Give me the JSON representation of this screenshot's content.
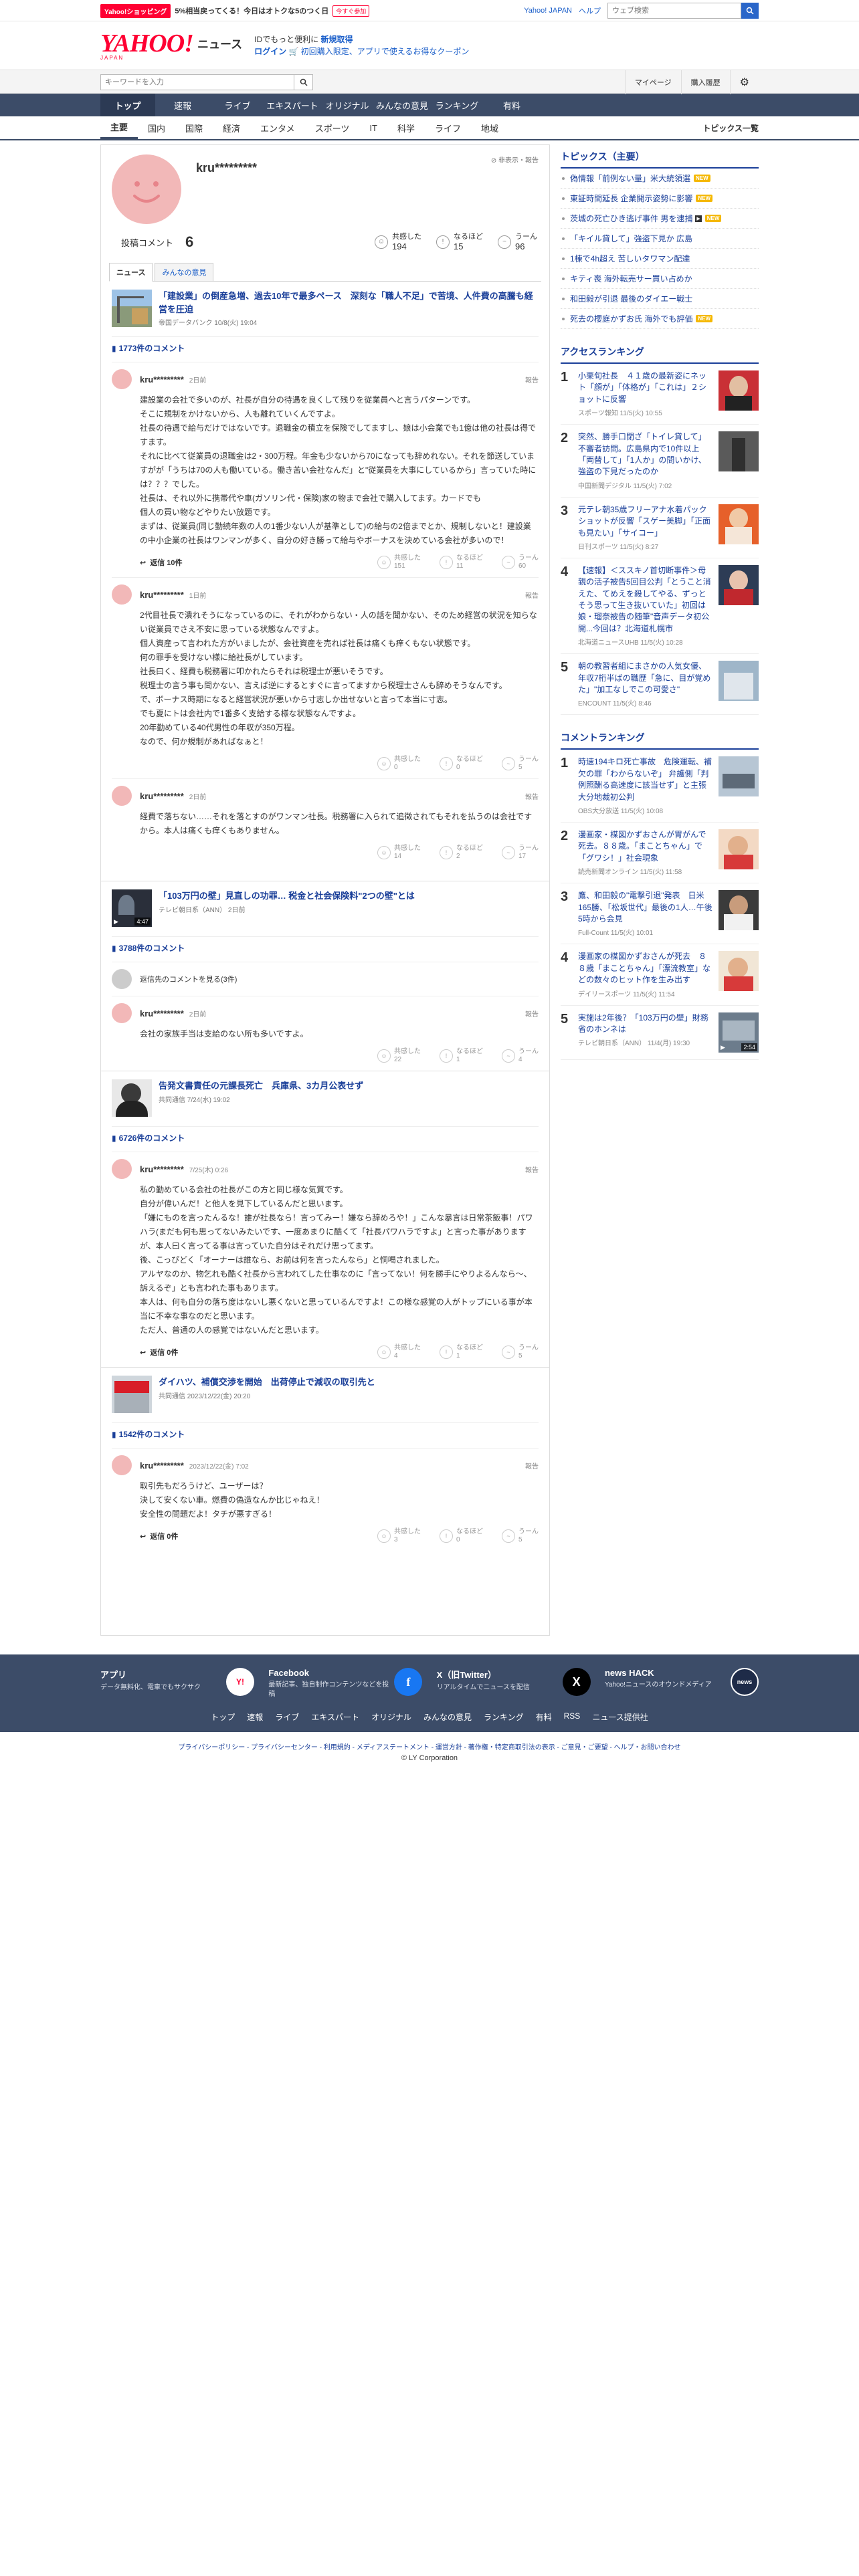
{
  "topbar": {
    "shop_badge": "Yahoo!ショッピング",
    "promo": "5%相当戻ってくる！今日はオトクな5のつく日",
    "promo_btn": "今すぐ参加",
    "links": [
      "Yahoo! JAPAN",
      "ヘルプ"
    ],
    "search_placeholder": "ウェブ検索"
  },
  "logo": {
    "main": "YAHOO!",
    "sub": "JAPAN",
    "section": "ニュース",
    "promo_line1_prefix": "IDでもっと便利に",
    "promo_line1_link": "新規取得",
    "promo_line2_login": "ログイン",
    "promo_line2_text": "初回購入限定、アプリで使えるお得なクーポン"
  },
  "subbar": {
    "keyword_placeholder": "キーワードを入力",
    "links": [
      "マイページ",
      "購入履歴"
    ]
  },
  "mainnav": [
    "トップ",
    "速報",
    "ライブ",
    "エキスパート",
    "オリジナル",
    "みんなの意見",
    "ランキング",
    "有料"
  ],
  "catnav": {
    "items": [
      "主要",
      "国内",
      "国際",
      "経済",
      "エンタメ",
      "スポーツ",
      "IT",
      "科学",
      "ライフ",
      "地域"
    ],
    "list_link": "トピックス一覧"
  },
  "profile": {
    "name": "kru*********",
    "report": "非表示・報告",
    "comments_label": "投稿コメント",
    "comments_count": "6",
    "reactions": [
      {
        "label": "共感した",
        "value": "194"
      },
      {
        "label": "なるほど",
        "value": "15"
      },
      {
        "label": "うーん",
        "value": "96"
      }
    ]
  },
  "tabs": [
    "ニュース",
    "みんなの意見"
  ],
  "threads": [
    {
      "title": "「建設業」の倒産急増、過去10年で最多ペース　深刻な「職人不足」で苦境、人件費の高騰も経営を圧迫",
      "meta": "帝国データバンク 10/8(火) 19:04",
      "comment_count": "1773件のコメント",
      "comments": [
        {
          "user": "kru*********",
          "time": "2日前",
          "report": "報告",
          "body": "建設業の会社で多いのが、社長が自分の待遇を良くして残りを従業員へと言うパターンです。\nそこに規制をかけないから、人も離れていくんですよ。\n社長の待遇で給与だけではないです。退職金の積立を保険でしてますし、娘は小会業でも1億は他の社長は得ですます。\nそれに比べて従業員の退職金は2・300万程。年金も少ないから70になっても辞めれない。それを節送していますがが「うちは70の人も働いている。働き苦い会社なんだ」と\"従業員を大事にしているから」言っていた時には？？？でした。\n社長は、それ以外に携帯代や車(ガソリン代・保険)家の物まで会社で購入してます。カードでも\n個人の買い物などやりたい放題です。\nまずは、従業員(同じ勤続年数の人の1番少ない人が基準として)の給与の2倍までとか、規制しないと！建設業の中小企業の社長はワンマンが多く、自分の好き勝って給与やボーナスを決めている会社が多いので！",
          "reply": "返信 10件",
          "reactions": [
            {
              "label": "共感した",
              "value": "151"
            },
            {
              "label": "なるほど",
              "value": "11"
            },
            {
              "label": "うーん",
              "value": "60"
            }
          ]
        },
        {
          "user": "kru*********",
          "time": "1日前",
          "report": "報告",
          "body": "2代目社長で潰れそうになっているのに、それがわからない・人の話を聞かない、そのため経営の状況を知らない従業員でさえ不安に思っている状態なんですよ。\n個人資産って言われた方がいましたが、会社資産を売れば社長は痛くも痒くもない状態です。\n何の罪手を受けない様に給社長がしています。\n社長曰く、経費も税務署に叩かれたらそれは税理士が悪いそうです。\n税理士の言う事も聞かない、言えば逆にするとすぐに言ってますから税理士さんも辞めそうなんです。\nで、ボーナス時期になると経営状況が悪いから寸志しか出せないと言って本当に寸志。\nでも夏にトは会社内で1番多く支給する様な状態なんですよ。\n20年勤めている40代男性の年収が350万程。\nなので、何か規制があればなぁと！",
          "reply": "",
          "reactions": [
            {
              "label": "共感した",
              "value": "0"
            },
            {
              "label": "なるほど",
              "value": "0"
            },
            {
              "label": "うーん",
              "value": "5"
            }
          ]
        },
        {
          "user": "kru*********",
          "time": "2日前",
          "report": "報告",
          "body": "経費で落ちない……それを落とすのがワンマン社長。税務署に入られて追徴されてもそれを払うのは会社ですから。本人は痛くも痒くもありません。",
          "reply": "",
          "reactions": [
            {
              "label": "共感した",
              "value": "14"
            },
            {
              "label": "なるほど",
              "value": "2"
            },
            {
              "label": "うーん",
              "value": "17"
            }
          ]
        }
      ]
    },
    {
      "title": "「103万円の壁」見直しの功罪… 税金と社会保険料\"2つの壁\"とは",
      "meta": "テレビ朝日系（ANN） 2日前",
      "video_time": "4:47",
      "comment_count": "3788件のコメント",
      "more": "返信先のコメントを見る(3件)",
      "comments": [
        {
          "user": "kru*********",
          "time": "2日前",
          "report": "報告",
          "body": "会社の家族手当は支給のない所も多いですよ。",
          "reply": "",
          "reactions": [
            {
              "label": "共感した",
              "value": "22"
            },
            {
              "label": "なるほど",
              "value": "1"
            },
            {
              "label": "うーん",
              "value": "4"
            }
          ]
        }
      ]
    },
    {
      "title": "告発文書責任の元課長死亡　兵庫県、3カ月公表せず",
      "meta": "共同通信 7/24(水) 19:02",
      "comment_count": "6726件のコメント",
      "comments": [
        {
          "user": "kru*********",
          "time": "7/25(木) 0:26",
          "report": "報告",
          "body": "私の勤めている会社の社長がこの方と同じ様な気質です。\n自分が偉いんだ！と他人を見下しているんだと思います。\n「嫌にものを言ったんるな！誰が社長なら！言ってみー！嫌なら辞めろや！」こんな暴言は日常茶飯事！パワハラ(まだも何も思ってないみたいです、一度あまりに酷くて「社長パワハラですよ」と言った事がありますが、本人曰く言ってる事は言っていた自分はそれだけ思ってます。\n後、こっぴどく「オーナーは誰なら、お前は何を言ったんなら」と恫喝されました。\nアルヤなのか、物乞れも酷く社長から言われてした仕事なのに「言ってない！何を勝手にやりよるんなら～、訴えるぞ」とも言われた事もあります。\n本人は、何も自分の落ち度はないし悪くないと思っているんですよ！この様な感覚の人がトップにいる事が本当に不幸な事なのだと思います。\nただ人、普通の人の感覚ではないんだと思います。",
          "reply": "返信 0件",
          "reactions": [
            {
              "label": "共感した",
              "value": "4"
            },
            {
              "label": "なるほど",
              "value": "1"
            },
            {
              "label": "うーん",
              "value": "5"
            }
          ]
        }
      ]
    },
    {
      "title": "ダイハツ、補償交渉を開始　出荷停止で減収の取引先と",
      "meta": "共同通信 2023/12/22(金) 20:20",
      "comment_count": "1542件のコメント",
      "comments": [
        {
          "user": "kru*********",
          "time": "2023/12/22(金) 7:02",
          "report": "報告",
          "body": "取引先もだろうけど、ユーザーは？\n決して安くない車。燃費の偽造なんか比じゃねえ！\n安全性の問題だよ！タチが悪すぎる！",
          "reply": "返信 0件",
          "reactions": [
            {
              "label": "共感した",
              "value": "3"
            },
            {
              "label": "なるほど",
              "value": "0"
            },
            {
              "label": "うーん",
              "value": "5"
            }
          ]
        }
      ]
    }
  ],
  "topics": {
    "heading": "トピックス（主要）",
    "items": [
      {
        "text": "偽情報「前例ない量」米大統領選",
        "new": "NEW",
        "video": false
      },
      {
        "text": "東証時間延長 企業開示姿勢に影響",
        "new": "NEW",
        "video": false
      },
      {
        "text": "茨城の死亡ひき逃げ事件 男を逮捕",
        "new": "NEW",
        "video": true
      },
      {
        "text": "「キイル貸して」強盗下見か 広島",
        "new": "",
        "video": false
      },
      {
        "text": "1棟で4h超え 苦しいタワマン配達",
        "new": "",
        "video": false
      },
      {
        "text": "キティ喪 海外転売サー買い占めか",
        "new": "",
        "video": false
      },
      {
        "text": "和田毅が引退 最後のダイエー戦士",
        "new": "",
        "video": false
      },
      {
        "text": "死去の櫻庭かずお氏 海外でも評価",
        "new": "NEW",
        "video": false
      }
    ],
    "new_label": "NEW"
  },
  "access_ranking": {
    "heading": "アクセスランキング",
    "items": [
      {
        "no": "1",
        "title": "小栗旬社長　４１歳の最新姿にネット「顔が」「体格が」「これは」２ショットに反響",
        "meta": "スポーツ報知 11/5(火) 10:55"
      },
      {
        "no": "2",
        "title": "突然、勝手口閉ざ「トイレ貸して」不審者訪問。広島県内で10件以上「両替して」「1人か」の問いかけ、強盗の下見だったのか",
        "meta": "中国新聞デジタル 11/5(火) 7:02"
      },
      {
        "no": "3",
        "title": "元テレ朝35歳フリーアナ水着パックショットが反響「スゲー美脚」「正面も見たい」「サイコー」",
        "meta": "日刊スポーツ 11/5(火) 8:27"
      },
      {
        "no": "4",
        "title": "【速報】＜ススキノ首切断事件＞母親の活子被告5回目公判「とうこと消えた、てめえを殺してやる、ずっとそう思って生き抜いていた」初回は娘・瑠奈被告の随筆\"音声データ初公開...今回は？北海道札幌市",
        "meta": "北海道ニュースUHB 11/5(火) 10:28"
      },
      {
        "no": "5",
        "title": "朝の教習者組にまさかの人気女優、年収7桁半ばの職歴「急に、目が覚めた」\"加工なしでこの可愛さ\"",
        "meta": "ENCOUNT 11/5(火) 8:46"
      }
    ]
  },
  "comment_ranking": {
    "heading": "コメントランキング",
    "items": [
      {
        "no": "1",
        "title": "時速194キロ死亡事故　危険運転、補欠の罪「わからないぞ」 弁護側「判例照酬る高速度に該当せず」と主張　大分地裁初公判",
        "meta": "OBS大分放送 11/5(火) 10:08",
        "video": ""
      },
      {
        "no": "2",
        "title": "漫画家・楳図かずおさんが胃がんで死去。８８歳。「まことちゃん」で「グワシ！」社会現象",
        "meta": "読売新聞オンライン 11/5(火) 11:58",
        "video": ""
      },
      {
        "no": "3",
        "title": "鷹、和田毅の\"電撃引退\"発表　日米165勝、「松坂世代」最後の1人…午後5時から会見",
        "meta": "Full-Count 11/5(火) 10:01",
        "video": ""
      },
      {
        "no": "4",
        "title": "漫画家の楳図かずおさんが死去　８８歳「まことちゃん」「漂流教室」などの数々のヒット作を生み出す",
        "meta": "デイリースポーツ 11/5(火) 11:54",
        "video": ""
      },
      {
        "no": "5",
        "title": "実施は2年後？「103万円の壁」財務省のホンネは",
        "meta": "テレビ朝日系（ANN） 11/4(月) 19:30",
        "video": "2:54"
      }
    ]
  },
  "footer": {
    "apps": [
      {
        "name": "アプリ",
        "desc": "データ無料化、電車でもサクサク",
        "icon": "app-icon"
      },
      {
        "name": "Facebook",
        "desc": "最新記事、独自制作コンテンツなどを投稿",
        "icon": "facebook-icon"
      },
      {
        "name": "X（旧Twitter）",
        "desc": "リアルタイムでニュースを配信",
        "icon": "x-icon"
      },
      {
        "name": "news HACK",
        "desc": "Yahoo!ニュースのオウンドメディア",
        "icon": "newshack-icon"
      }
    ],
    "nav": [
      "トップ",
      "速報",
      "ライブ",
      "エキスパート",
      "オリジナル",
      "みんなの意見",
      "ランキング",
      "有料",
      "RSS",
      "ニュース提供社"
    ],
    "links": "プライバシーポリシー - プライバシーセンター - 利用規約 - メディアステートメント - 運営方針 - 著作権・特定商取引法の表示 - ご意見・ご要望 - ヘルプ・お問い合わせ",
    "copyright": "© LY Corporation"
  },
  "colors": {
    "brand": "#ff0033",
    "nav": "#3c4c68",
    "link": "#1a3f99",
    "avatar": "#f2b8b8"
  }
}
